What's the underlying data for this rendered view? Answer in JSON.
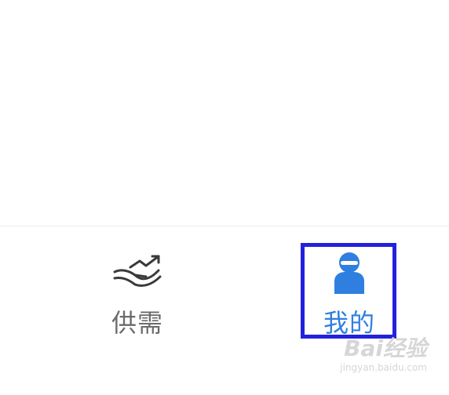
{
  "tab_bar": {
    "tabs": [
      {
        "label": "供需",
        "icon": "hand-growth-icon",
        "color": "#6b6b6b",
        "active": false
      },
      {
        "label": "我的",
        "icon": "user-profile-icon",
        "color": "#2f7fe0",
        "active": true
      }
    ]
  },
  "annotation": {
    "highlight_color": "#2222dd"
  },
  "watermark": {
    "logo_text": "Bai经验",
    "url": "jingyan.baidu.com"
  }
}
